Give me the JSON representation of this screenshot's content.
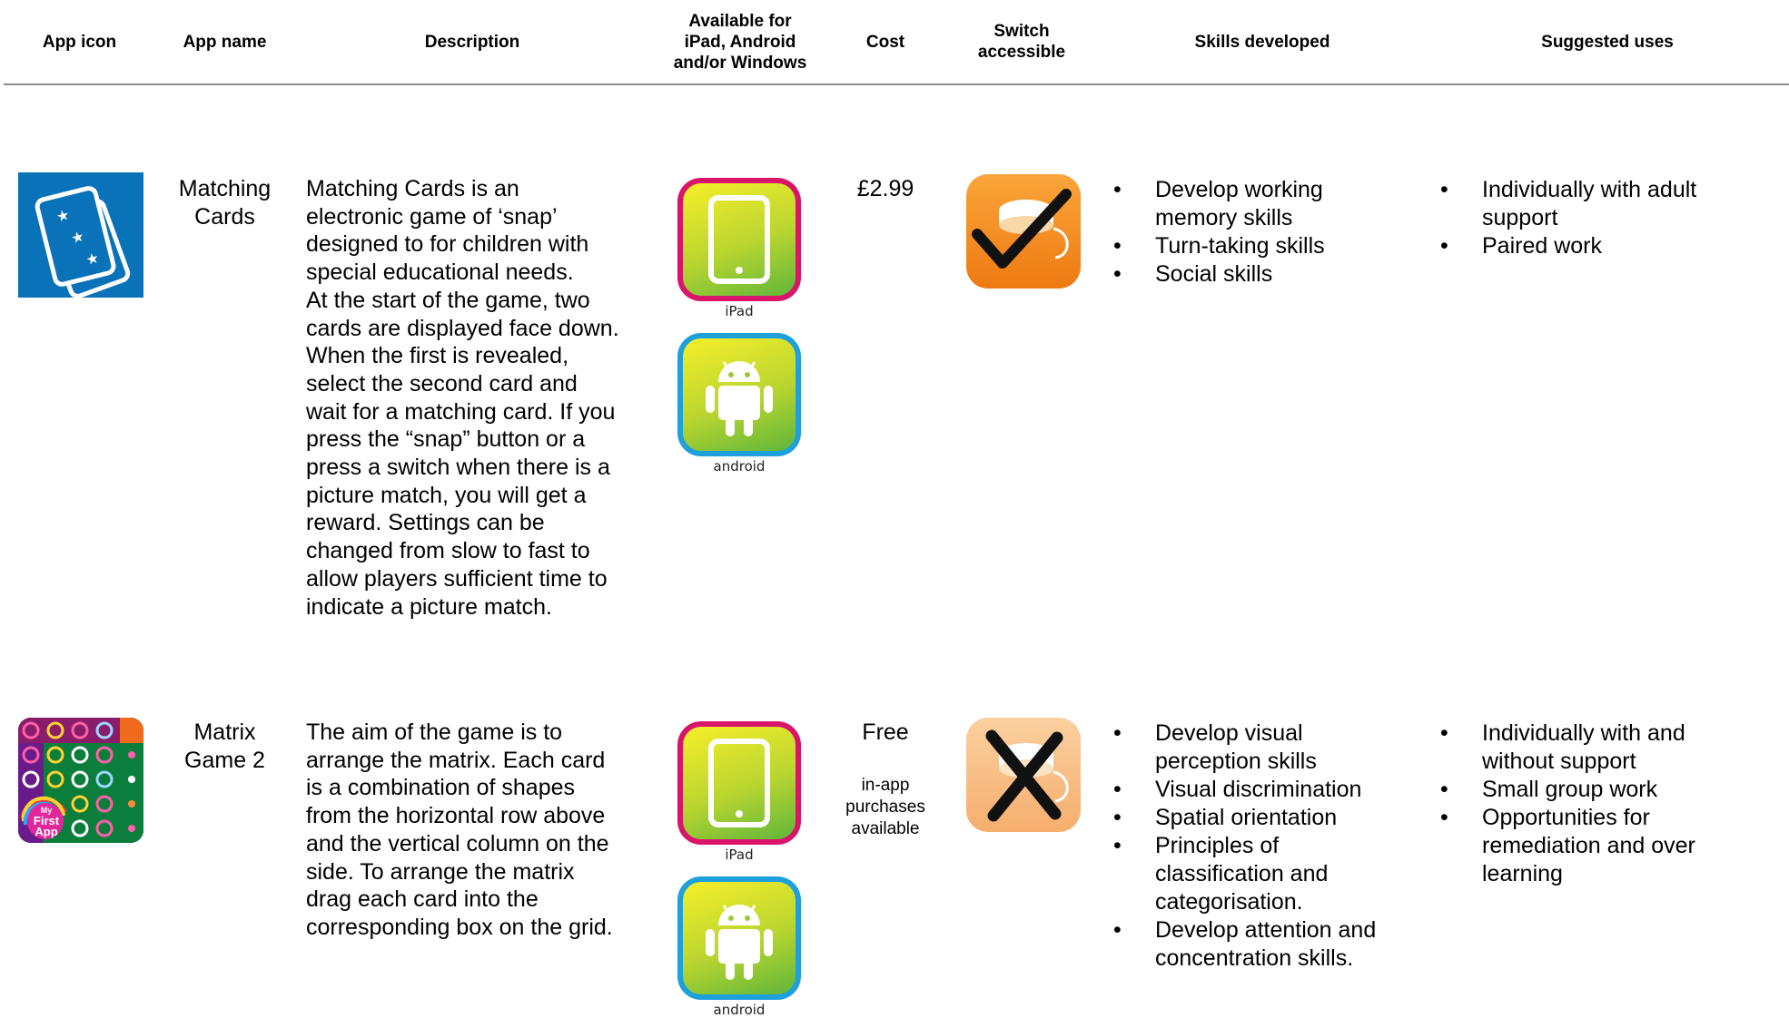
{
  "headers": {
    "app_icon": "App icon",
    "app_name": "App name",
    "description": "Description",
    "available_line1": "Available for",
    "available_line2": "iPad, Android",
    "available_line3": "and/or Windows",
    "cost": "Cost",
    "switch_line1": "Switch",
    "switch_line2": "accessible",
    "skills": "Skills developed",
    "uses": "Suggested uses"
  },
  "rows": [
    {
      "icon": "matching-cards-app-icon",
      "name_line1": "Matching",
      "name_line2": "Cards",
      "description": [
        "Matching Cards is an",
        "electronic game of ‘snap’",
        "designed to for children with",
        "special educational needs.",
        "At the start of the game, two",
        "cards are displayed face down.",
        "When the first is revealed,",
        "select the second card and",
        "wait for a matching card. If you",
        "press the “snap” button or a",
        "press a switch when there is a",
        "picture match, you will get a",
        "reward. Settings can be",
        "changed from slow to fast to",
        "allow players sufficient time to",
        "indicate a picture match."
      ],
      "platforms": [
        "iPad",
        "android"
      ],
      "cost": "£2.99",
      "cost_note": [],
      "switch_accessible": true,
      "skills": [
        [
          "Develop working",
          "memory skills"
        ],
        [
          "Turn-taking skills"
        ],
        [
          "Social skills"
        ]
      ],
      "uses": [
        [
          "Individually with adult",
          "support"
        ],
        [
          "Paired work"
        ]
      ]
    },
    {
      "icon": "matrix-game-app-icon",
      "name_line1": "Matrix",
      "name_line2": "Game 2",
      "description": [
        "The aim of the game is to",
        "arrange the matrix. Each card",
        "is a combination of shapes",
        "from the horizontal row above",
        "and the vertical column on the",
        "side. To arrange the matrix",
        "drag each card into the",
        "corresponding box on the grid."
      ],
      "platforms": [
        "iPad",
        "android"
      ],
      "cost": "Free",
      "cost_note": [
        "in-app",
        "purchases",
        "available"
      ],
      "switch_accessible": false,
      "skills": [
        [
          "Develop visual",
          "perception skills"
        ],
        [
          "Visual discrimination"
        ],
        [
          "Spatial orientation"
        ],
        [
          "Principles of",
          "classification and",
          "categorisation."
        ],
        [
          "Develop attention and",
          "concentration skills."
        ]
      ],
      "uses": [
        [
          "Individually with and",
          "without support"
        ],
        [
          "Small group work"
        ],
        [
          "Opportunities for",
          "remediation and over",
          "learning"
        ]
      ]
    }
  ],
  "logo_text": {
    "my": "My",
    "first": "First",
    "app": "App"
  },
  "colors": {
    "card_blue": "#0a72b8",
    "ipad_border": "#d8156b",
    "android_border": "#1ea0dd",
    "switch_orange": "#f07d14",
    "switch_orange_faded": "#f7b47c"
  }
}
